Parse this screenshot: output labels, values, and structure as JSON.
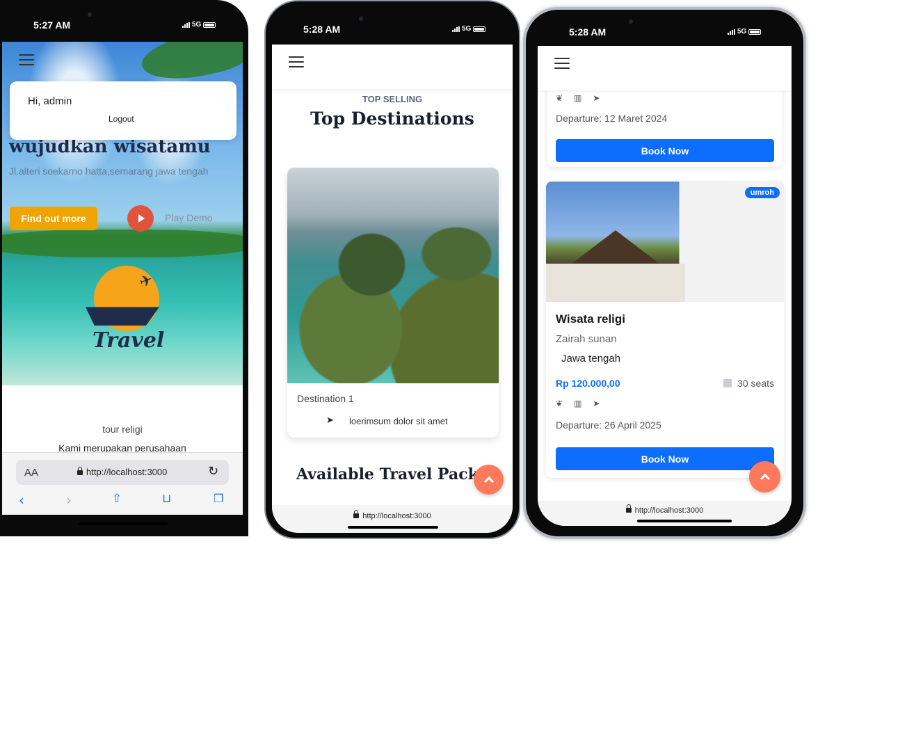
{
  "phone1": {
    "time": "5:27 AM",
    "network": "5G",
    "greeting": "Hi, admin",
    "logout_label": "Logout",
    "hero_title": "wujudkan wisatamu",
    "hero_subtitle": "Jl.alteri soekarno hatta,semarang jawa tengah",
    "find_out_more_label": "Find out more",
    "play_demo_label": "Play Demo",
    "logo_text": "Travel",
    "section_label": "tour religi",
    "section_text": "Kami merupakan perusahaan",
    "browser": {
      "text_size_label": "AA",
      "url": "http://localhost:3000",
      "nav_icons": [
        "back-icon",
        "forward-icon",
        "share-icon",
        "bookmarks-icon",
        "tabs-icon"
      ]
    }
  },
  "phone2": {
    "time": "5:28 AM",
    "network": "5G",
    "kicker": "TOP SELLING",
    "title": "Top Destinations",
    "destination": {
      "name": "Destination 1",
      "location": "loerimsum dolor sit amet"
    },
    "next_section_title": "Available Travel Packag",
    "url": "http://localhost:3000"
  },
  "phone3": {
    "time": "5:28 AM",
    "network": "5G",
    "prev_card": {
      "departure": "Departure: 12 Maret 2024",
      "book_label": "Book Now"
    },
    "card": {
      "badge": "umroh",
      "title": "Wisata religi",
      "subtitle": "Zairah sunan",
      "location": "Jawa tengah",
      "price": "Rp 120.000,00",
      "seats": "30 seats",
      "departure": "Departure: 26 April 2025",
      "book_label": "Book Now"
    },
    "url": "http://localhost:3000"
  },
  "colors": {
    "primary_blue": "#0d6efd",
    "accent_orange": "#f0a400",
    "play_red": "#e0533d",
    "fab_coral": "#ff7a5c"
  }
}
